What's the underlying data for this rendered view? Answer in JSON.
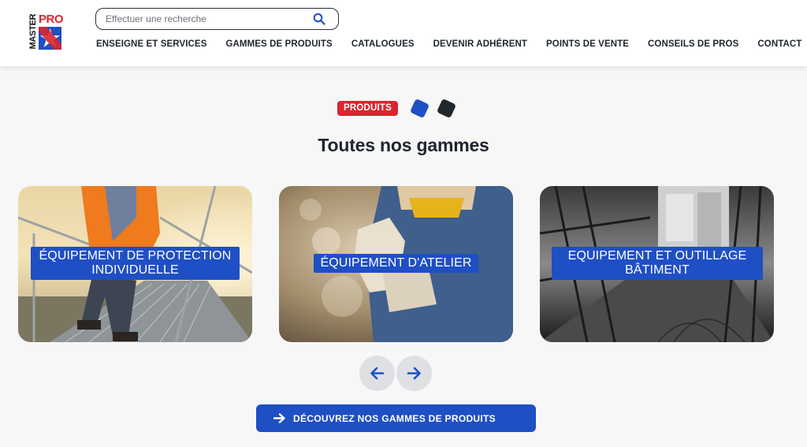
{
  "brand": {
    "logo_top": "PRO",
    "logo_side": "MASTER"
  },
  "search": {
    "placeholder": "Effectuer une recherche"
  },
  "nav": {
    "items": [
      {
        "label": "ENSEIGNE ET SERVICES"
      },
      {
        "label": "GAMMES DE PRODUITS"
      },
      {
        "label": "CATALOGUES"
      },
      {
        "label": "DEVENIR ADHÉRENT"
      },
      {
        "label": "POINTS DE VENTE"
      },
      {
        "label": "CONSEILS DE PROS"
      },
      {
        "label": "CONTACT"
      }
    ]
  },
  "section": {
    "tag": "PRODUITS",
    "title": "Toutes nos gammes"
  },
  "cards": [
    {
      "label": "ÉQUIPEMENT DE PROTECTION INDIVIDUELLE"
    },
    {
      "label": "ÉQUIPEMENT D'ATELIER"
    },
    {
      "label": "EQUIPEMENT ET OUTILLAGE BÂTIMENT"
    }
  ],
  "cta": {
    "label": "DÉCOUVREZ NOS GAMMES DE PRODUITS"
  },
  "colors": {
    "primary": "#1f4fc4",
    "accent": "#d8262c",
    "dark": "#22262d"
  },
  "icons": {
    "search": "search-icon",
    "prev": "arrow-left-icon",
    "next": "arrow-right-icon",
    "cta": "arrow-right-icon"
  }
}
